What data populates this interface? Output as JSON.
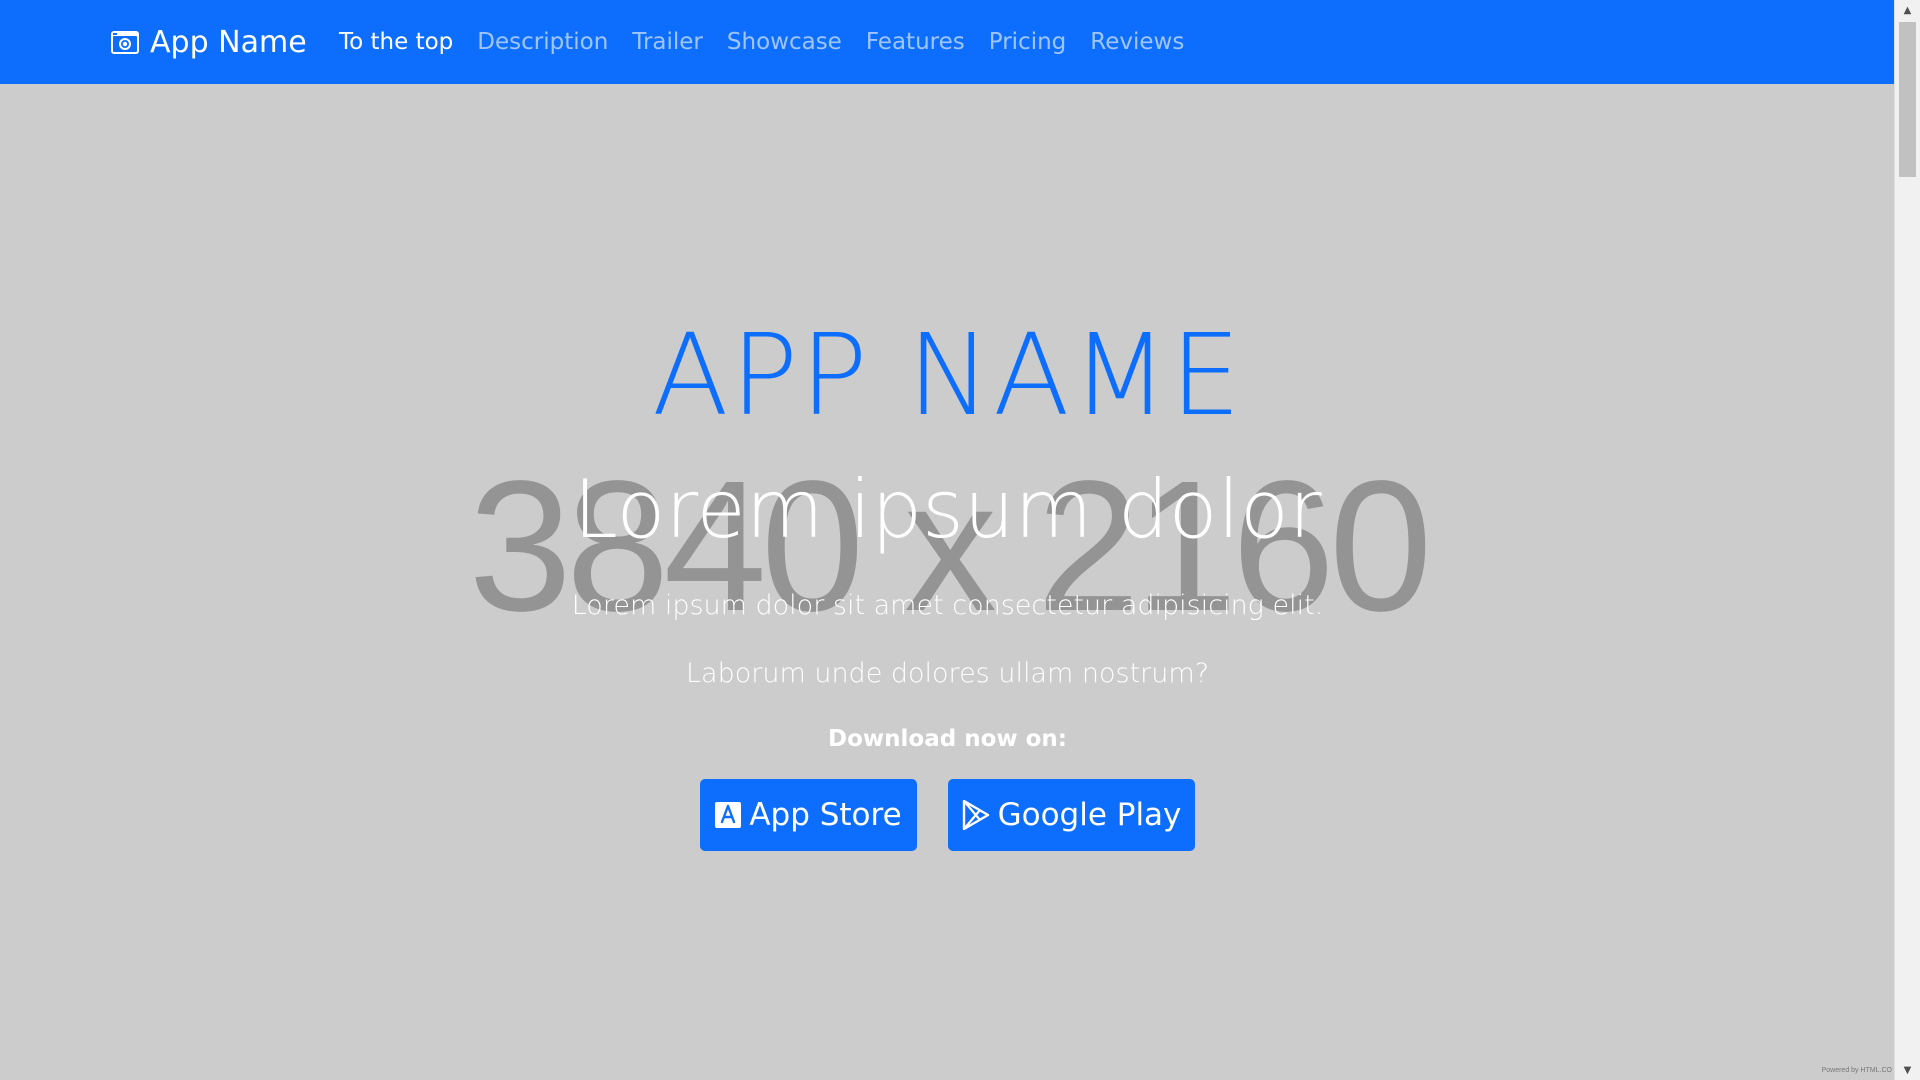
{
  "brand": {
    "name": "App Name",
    "icon": "camera-icon"
  },
  "nav": {
    "items": [
      {
        "label": "To the top",
        "active": true
      },
      {
        "label": "Description",
        "active": false
      },
      {
        "label": "Trailer",
        "active": false
      },
      {
        "label": "Showcase",
        "active": false
      },
      {
        "label": "Features",
        "active": false
      },
      {
        "label": "Pricing",
        "active": false
      },
      {
        "label": "Reviews",
        "active": false
      }
    ]
  },
  "hero": {
    "background_placeholder": "3840 x 2160",
    "title": "APP NAME",
    "subtitle": "Lorem ipsum dolor",
    "text_line1": "Lorem ipsum dolor sit amet consectetur adipisicing elit.",
    "text_line2": "Laborum unde dolores ullam nostrum?",
    "download_label": "Download now on:",
    "buttons": {
      "appstore": {
        "label": "App Store",
        "icon": "app-store-icon"
      },
      "googleplay": {
        "label": "Google Play",
        "icon": "google-play-icon"
      }
    }
  },
  "footer_note": "Powered by HTML.CO",
  "colors": {
    "primary": "#0d6efd",
    "background": "#cccccc",
    "white": "#ffffff"
  }
}
